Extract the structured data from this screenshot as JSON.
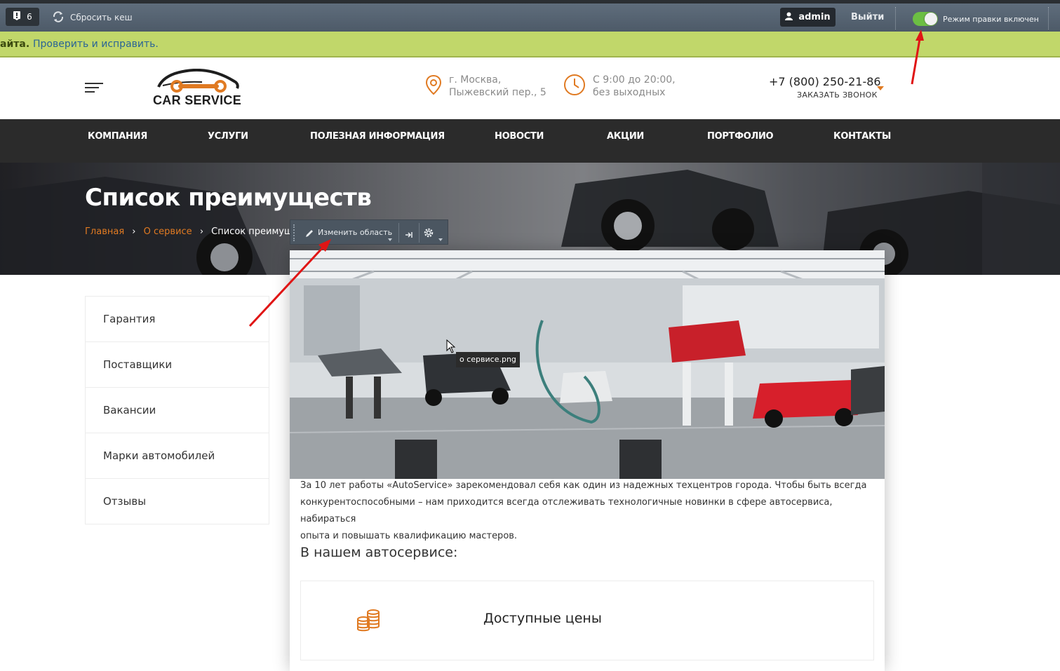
{
  "admin_panel": {
    "notifications_count": "6",
    "clear_cache_label": "Сбросить кеш",
    "user_label": "admin",
    "logout_label": "Выйти",
    "edit_mode_label": "Режим правки включен",
    "edit_mode_on": true
  },
  "warning": {
    "text": "айта.",
    "link": "Проверить и исправить."
  },
  "header": {
    "logo_text": "CAR SERVICE",
    "address_line1": "г. Москва,",
    "address_line2": "Пыжевский пер., 5",
    "hours_line1": "С 9:00 до 20:00,",
    "hours_line2": "без выходных",
    "phone": "+7 (800) 250-21-86",
    "callback_label": "ЗАКАЗАТЬ ЗВОНОК"
  },
  "nav": {
    "items": [
      "КОМПАНИЯ",
      "УСЛУГИ",
      "ПОЛЕЗНАЯ ИНФОРМАЦИЯ",
      "НОВОСТИ",
      "АКЦИИ",
      "ПОРТФОЛИО",
      "КОНТАКТЫ"
    ]
  },
  "hero": {
    "title": "Список преимуществ",
    "breadcrumbs": [
      "Главная",
      "О сервисе",
      "Список преимуществ"
    ]
  },
  "edit_toolbar": {
    "edit_area_label": "Изменить область"
  },
  "sidebar": {
    "items": [
      "Гарантия",
      "Поставщики",
      "Вакансии",
      "Марки автомобилей",
      "Отзывы"
    ]
  },
  "content": {
    "image_tooltip": "о сервисе.png",
    "paragraph_line1": "За 10 лет работы «AutoService» зарекомендовал себя как один из надежных техцентров города. Чтобы быть всегда",
    "paragraph_line2": "конкурентоспособными – нам приходится всегда отслеживать технологичные новинки в сфере автосервиса, набираться",
    "paragraph_line3": "опыта и повышать квалификацию мастеров.",
    "subheading": "В нашем автосервисе:",
    "feature_title": "Доступные цены"
  },
  "colors": {
    "accent_orange": "#e07a22",
    "admin_bar": "#56626f",
    "warning_bg": "#c1d76a",
    "nav_bg": "#2b2b2b",
    "toggle_on": "#6cbf43"
  }
}
